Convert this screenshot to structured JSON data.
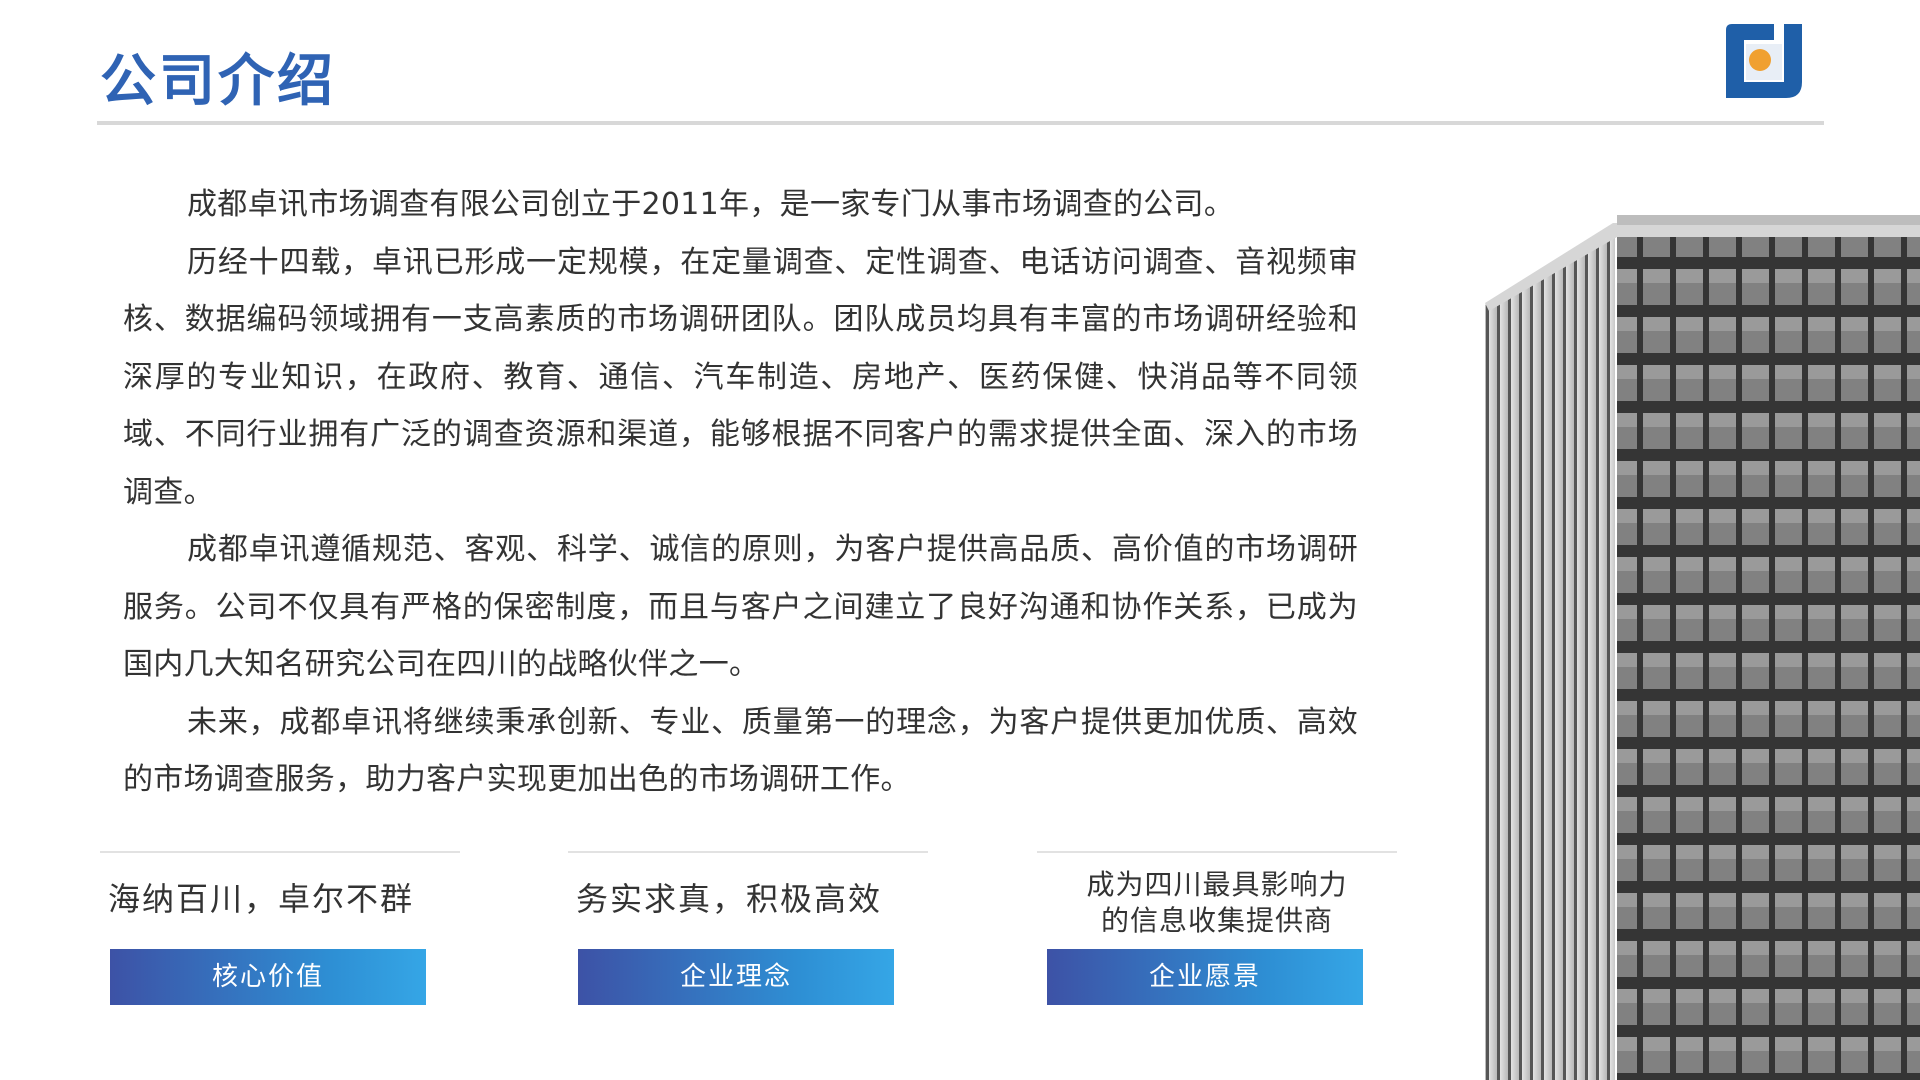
{
  "header": {
    "title": "公司介绍"
  },
  "intro": {
    "paragraphs": [
      "成都卓讯市场调查有限公司创立于2011年，是一家专门从事市场调查的公司。",
      "历经十四载，卓讯已形成一定规模，在定量调查、定性调查、电话访问调查、音视频审核、数据编码领域拥有一支高素质的市场调研团队。团队成员均具有丰富的市场调研经验和深厚的专业知识，在政府、教育、通信、汽车制造、房地产、医药保健、快消品等不同领域、不同行业拥有广泛的调查资源和渠道，能够根据不同客户的需求提供全面、深入的市场调查。",
      "成都卓讯遵循规范、客观、科学、诚信的原则，为客户提供高品质、高价值的市场调研服务。公司不仅具有严格的保密制度，而且与客户之间建立了良好沟通和协作关系，已成为国内几大知名研究公司在四川的战略伙伴之一。",
      "未来，成都卓讯将继续秉承创新、专业、质量第一的理念，为客户提供更加优质、高效的市场调查服务，助力客户实现更加出色的市场调研工作。"
    ]
  },
  "cards": [
    {
      "text": "海纳百川，卓尔不群",
      "label": "核心价值"
    },
    {
      "text": "务实求真，积极高效",
      "label": "企业理念"
    },
    {
      "text_line1": "成为四川最具影响力",
      "text_line2": "的信息收集提供商",
      "label": "企业愿景"
    }
  ],
  "colors": {
    "title": "#2f63b4",
    "logo_blue": "#1f5fa8",
    "logo_orange": "#f0a030",
    "button_start": "#3d52a6",
    "button_end": "#35a6e6"
  },
  "icons": {
    "logo": "company-logo",
    "building": "office-building-image"
  }
}
